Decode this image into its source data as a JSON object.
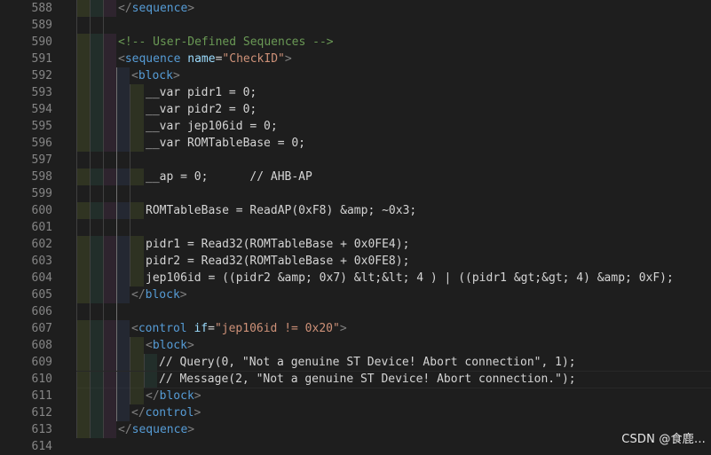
{
  "editor": {
    "colors": {
      "background": "#1e1e1e",
      "line_number": "#858585",
      "tag": "#569cd6",
      "attribute": "#9cdcfe",
      "string": "#ce9178",
      "comment": "#6a9955",
      "text": "#d4d4d4",
      "bracket": "#808080"
    },
    "current_line": 610,
    "lines": [
      {
        "n": "588",
        "indent": 3,
        "tokens": [
          [
            "br",
            "</"
          ],
          [
            "tag",
            "sequence"
          ],
          [
            "br",
            ">"
          ]
        ]
      },
      {
        "n": "589",
        "indent": 0,
        "tokens": []
      },
      {
        "n": "590",
        "indent": 3,
        "tokens": [
          [
            "com",
            "<!-- User-Defined Sequences -->"
          ]
        ]
      },
      {
        "n": "591",
        "indent": 3,
        "tokens": [
          [
            "br",
            "<"
          ],
          [
            "tag",
            "sequence"
          ],
          [
            "txt",
            " "
          ],
          [
            "attr",
            "name"
          ],
          [
            "op",
            "="
          ],
          [
            "str",
            "\"CheckID\""
          ],
          [
            "br",
            ">"
          ]
        ]
      },
      {
        "n": "592",
        "indent": 4,
        "tokens": [
          [
            "br",
            "<"
          ],
          [
            "tag",
            "block"
          ],
          [
            "br",
            ">"
          ]
        ]
      },
      {
        "n": "593",
        "indent": 5,
        "tokens": [
          [
            "txt",
            "__var pidr1 = 0;"
          ]
        ]
      },
      {
        "n": "594",
        "indent": 5,
        "tokens": [
          [
            "txt",
            "__var pidr2 = 0;"
          ]
        ]
      },
      {
        "n": "595",
        "indent": 5,
        "tokens": [
          [
            "txt",
            "__var jep106id = 0;"
          ]
        ]
      },
      {
        "n": "596",
        "indent": 5,
        "tokens": [
          [
            "txt",
            "__var ROMTableBase = 0;"
          ]
        ]
      },
      {
        "n": "597",
        "indent": 0,
        "tokens": []
      },
      {
        "n": "598",
        "indent": 5,
        "tokens": [
          [
            "txt",
            "__ap = 0;      // AHB-AP"
          ]
        ]
      },
      {
        "n": "599",
        "indent": 0,
        "tokens": []
      },
      {
        "n": "600",
        "indent": 5,
        "tokens": [
          [
            "txt",
            "ROMTableBase = ReadAP(0xF8) &amp; ~0x3;"
          ]
        ]
      },
      {
        "n": "601",
        "indent": 0,
        "tokens": []
      },
      {
        "n": "602",
        "indent": 5,
        "tokens": [
          [
            "txt",
            "pidr1 = Read32(ROMTableBase + 0x0FE4);"
          ]
        ]
      },
      {
        "n": "603",
        "indent": 5,
        "tokens": [
          [
            "txt",
            "pidr2 = Read32(ROMTableBase + 0x0FE8);"
          ]
        ]
      },
      {
        "n": "604",
        "indent": 5,
        "tokens": [
          [
            "txt",
            "jep106id = ((pidr2 &amp; 0x7) &lt;&lt; 4 ) | ((pidr1 &gt;&gt; 4) &amp; 0xF);"
          ]
        ]
      },
      {
        "n": "605",
        "indent": 4,
        "tokens": [
          [
            "br",
            "</"
          ],
          [
            "tag",
            "block"
          ],
          [
            "br",
            ">"
          ]
        ]
      },
      {
        "n": "606",
        "indent": 0,
        "tokens": []
      },
      {
        "n": "607",
        "indent": 4,
        "tokens": [
          [
            "br",
            "<"
          ],
          [
            "tag",
            "control"
          ],
          [
            "txt",
            " "
          ],
          [
            "attr",
            "if"
          ],
          [
            "op",
            "="
          ],
          [
            "str",
            "\"jep106id != 0x20\""
          ],
          [
            "br",
            ">"
          ]
        ]
      },
      {
        "n": "608",
        "indent": 5,
        "tokens": [
          [
            "br",
            "<"
          ],
          [
            "tag",
            "block"
          ],
          [
            "br",
            ">"
          ]
        ]
      },
      {
        "n": "609",
        "indent": 6,
        "tokens": [
          [
            "txt",
            "// Query(0, \"Not a genuine ST Device! Abort connection\", 1);"
          ]
        ]
      },
      {
        "n": "610",
        "indent": 6,
        "tokens": [
          [
            "txt",
            "// Message(2, \"Not a genuine ST Device! Abort connection.\");"
          ]
        ]
      },
      {
        "n": "611",
        "indent": 5,
        "tokens": [
          [
            "br",
            "</"
          ],
          [
            "tag",
            "block"
          ],
          [
            "br",
            ">"
          ]
        ]
      },
      {
        "n": "612",
        "indent": 4,
        "tokens": [
          [
            "br",
            "</"
          ],
          [
            "tag",
            "control"
          ],
          [
            "br",
            ">"
          ]
        ]
      },
      {
        "n": "613",
        "indent": 3,
        "tokens": [
          [
            "br",
            "</"
          ],
          [
            "tag",
            "sequence"
          ],
          [
            "br",
            ">"
          ]
        ]
      },
      {
        "n": "614",
        "indent": 0,
        "tokens": []
      }
    ]
  },
  "watermark": {
    "text": "CSDN @食鹿..."
  }
}
